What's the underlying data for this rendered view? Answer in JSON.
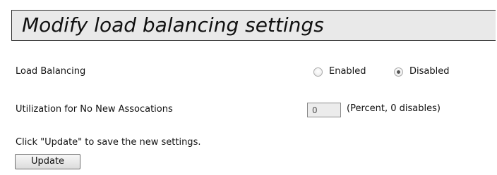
{
  "header": {
    "title": "Modify load balancing settings"
  },
  "load_balancing": {
    "label": "Load Balancing",
    "options": [
      {
        "label": "Enabled",
        "selected": false
      },
      {
        "label": "Disabled",
        "selected": true
      }
    ]
  },
  "utilization": {
    "label": "Utilization for No New Assocations",
    "value": "0",
    "hint": "(Percent, 0 disables)"
  },
  "footer": {
    "instruction": "Click \"Update\" to save the new settings.",
    "update_label": "Update"
  }
}
